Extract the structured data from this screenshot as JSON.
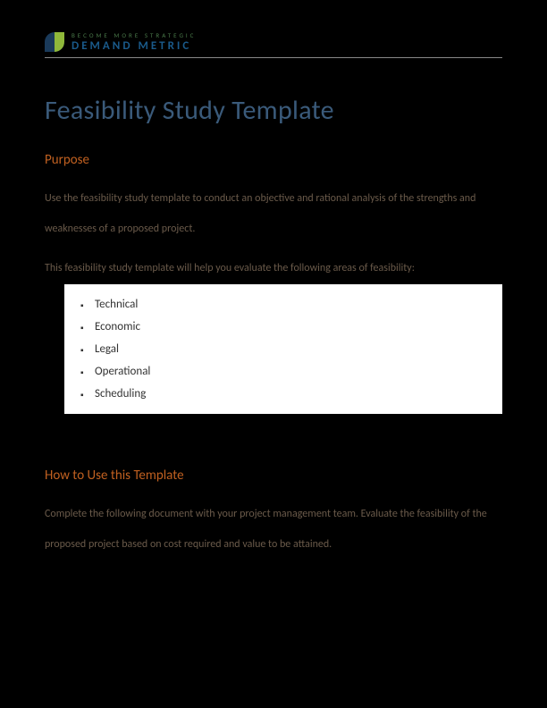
{
  "logo": {
    "tagline": "Become More Strategic",
    "brand": "DEMAND METRIC"
  },
  "title": "Feasibility Study Template",
  "section1": {
    "heading": "Purpose",
    "paragraph1": "Use the feasibility study template to conduct an objective and rational analysis of the strengths and weaknesses of a proposed project.",
    "paragraph2": "This feasibility study template will help you evaluate the following areas of feasibility:",
    "items": [
      "Technical",
      "Economic",
      "Legal",
      "Operational",
      "Scheduling"
    ]
  },
  "section2": {
    "heading": "How to Use this Template",
    "paragraph": "Complete the following document with your project management team. Evaluate the feasibility of the proposed project based on cost required and value to be attained."
  }
}
